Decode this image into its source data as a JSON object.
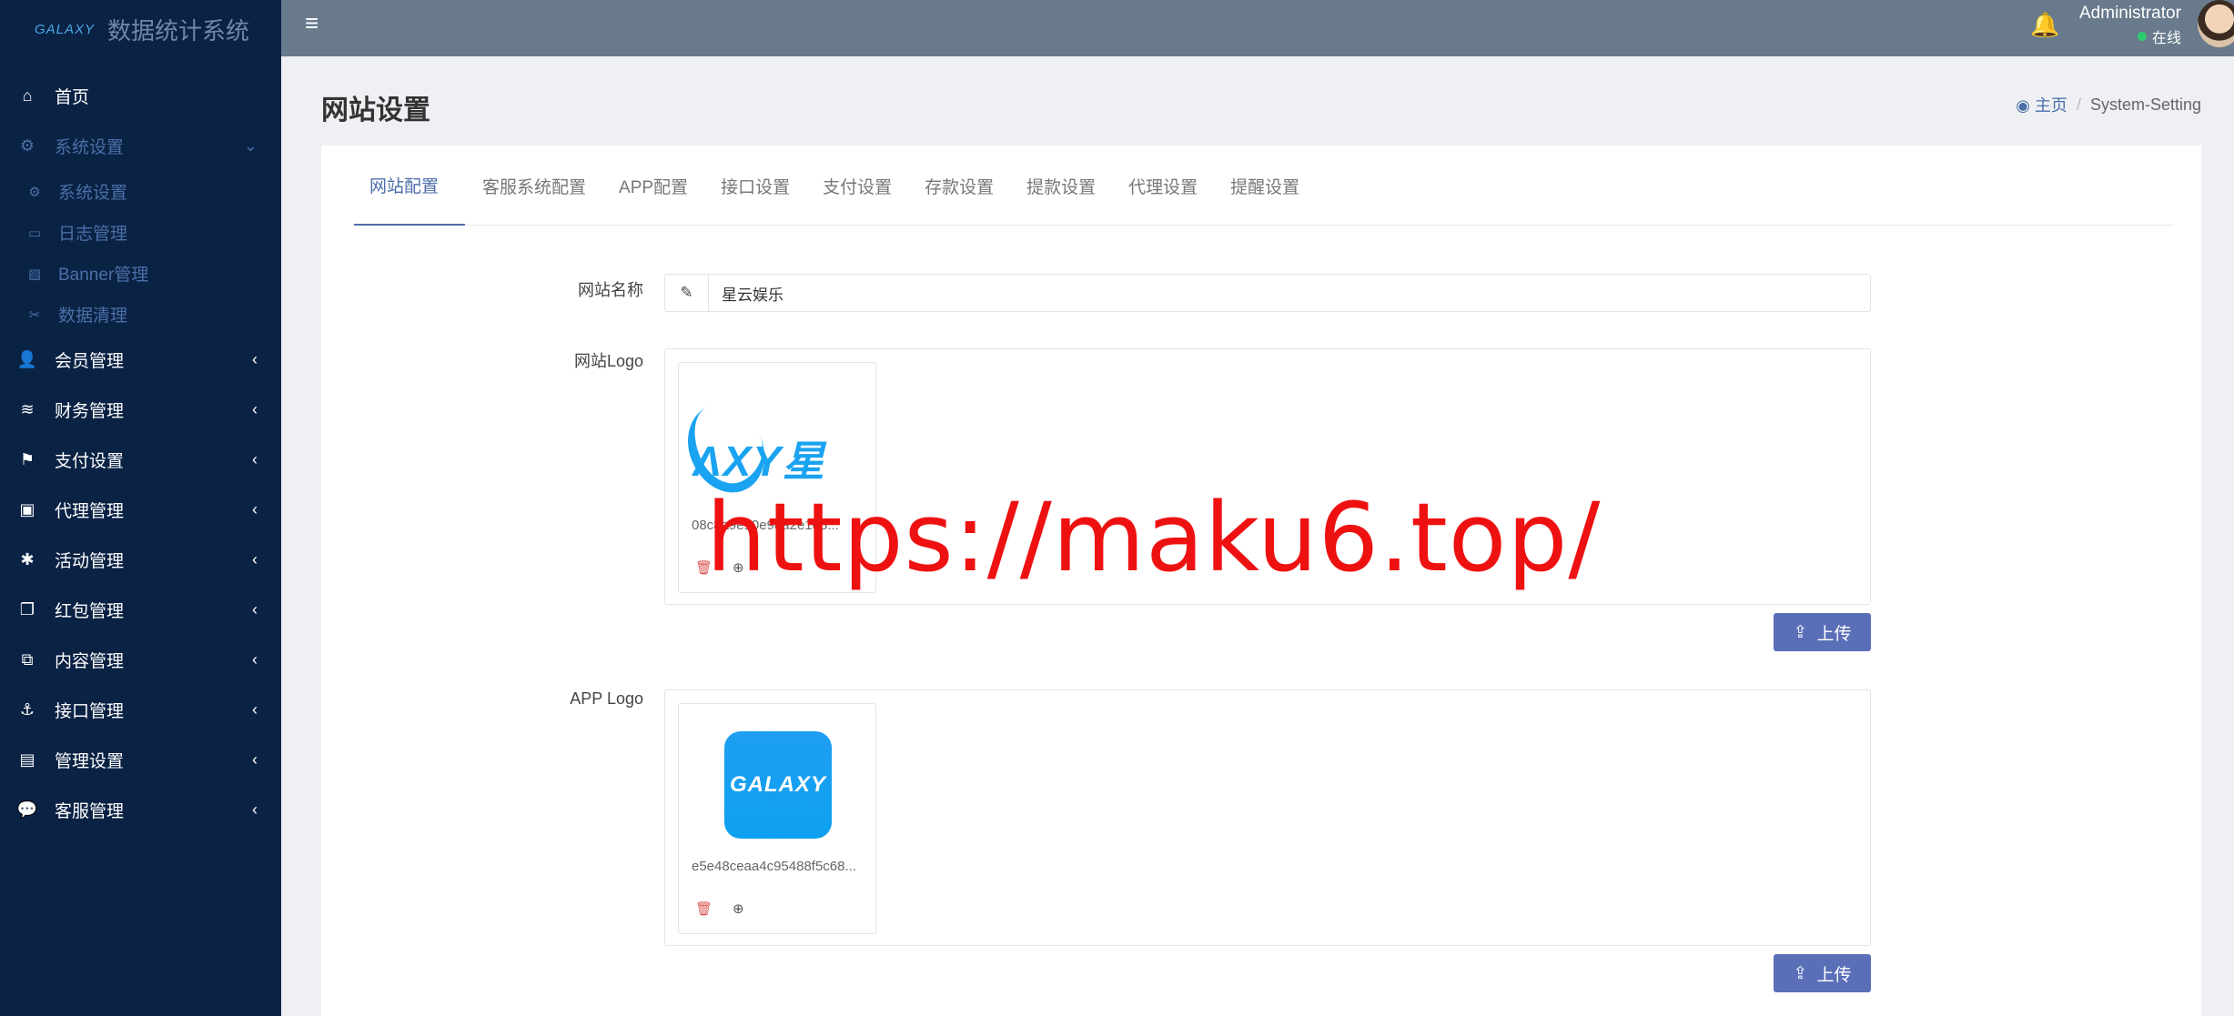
{
  "brand": {
    "logo_text": "GALAXY",
    "title": "数据统计系统"
  },
  "sidebar": {
    "items": [
      {
        "label": "首页",
        "icon": "home-icon",
        "glyph": "⌂"
      },
      {
        "label": "系统设置",
        "icon": "cogs-icon",
        "glyph": "⚙",
        "expanded": true
      },
      {
        "label": "会员管理",
        "icon": "user-icon",
        "glyph": "👤"
      },
      {
        "label": "财务管理",
        "icon": "database-icon",
        "glyph": "≋"
      },
      {
        "label": "支付设置",
        "icon": "bookmark-icon",
        "glyph": "⚑"
      },
      {
        "label": "代理管理",
        "icon": "contact-icon",
        "glyph": "▣"
      },
      {
        "label": "活动管理",
        "icon": "activity-icon",
        "glyph": "✱"
      },
      {
        "label": "红包管理",
        "icon": "clone-icon",
        "glyph": "❐"
      },
      {
        "label": "内容管理",
        "icon": "copy-icon",
        "glyph": "⧉"
      },
      {
        "label": "接口管理",
        "icon": "anchor-icon",
        "glyph": "⚓"
      },
      {
        "label": "管理设置",
        "icon": "id-card-icon",
        "glyph": "▤"
      },
      {
        "label": "客服管理",
        "icon": "comments-icon",
        "glyph": "💬"
      }
    ],
    "sub_items": [
      {
        "label": "系统设置",
        "icon": "gear-icon",
        "glyph": "⚙"
      },
      {
        "label": "日志管理",
        "icon": "file-icon",
        "glyph": "▭"
      },
      {
        "label": "Banner管理",
        "icon": "image-icon",
        "glyph": "▨"
      },
      {
        "label": "数据清理",
        "icon": "scissors-icon",
        "glyph": "✂"
      }
    ]
  },
  "header": {
    "user_name": "Administrator",
    "status": "在线"
  },
  "page": {
    "title": "网站设置",
    "breadcrumb_home": "主页",
    "breadcrumb_current": "System-Setting"
  },
  "tabs": [
    "网站配置",
    "客服系统配置",
    "APP配置",
    "接口设置",
    "支付设置",
    "存款设置",
    "提款设置",
    "代理设置",
    "提醒设置"
  ],
  "form": {
    "site_name_label": "网站名称",
    "site_name_value": "星云娱乐",
    "site_logo_label": "网站Logo",
    "site_logo_text": "ΛXY星",
    "site_logo_file": "08c8a9e10e98a2e1e8...",
    "app_logo_label": "APP Logo",
    "app_logo_text": "GALAXY",
    "app_logo_file": "e5e48ceaa4c95488f5c68...",
    "upload_label": "上传"
  },
  "watermark": "https://maku6.top/",
  "colors": {
    "sidebar_bg": "#0a2244",
    "header_bg": "#687a8c",
    "accent": "#4c6fa8",
    "button": "#5a6fb8",
    "watermark": "#ee1111"
  }
}
